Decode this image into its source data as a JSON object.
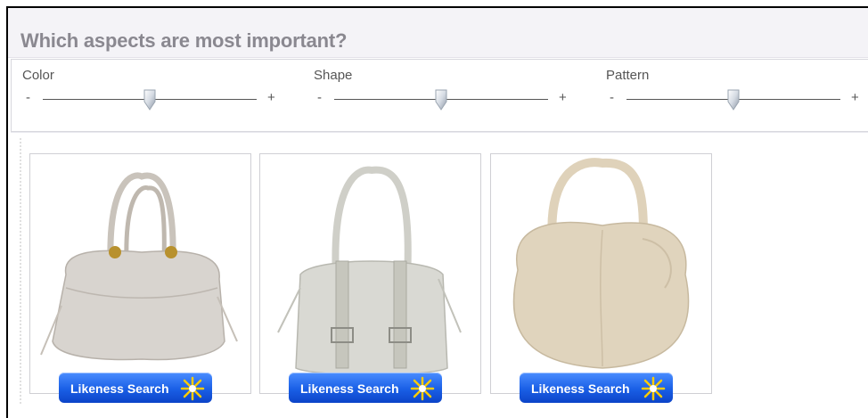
{
  "header": {
    "title": "Which aspects are most important?"
  },
  "sliders": [
    {
      "label": "Color",
      "minus": "-",
      "plus": "+",
      "value": 0.47
    },
    {
      "label": "Shape",
      "minus": "-",
      "plus": "+",
      "value": 0.47
    },
    {
      "label": "Pattern",
      "minus": "-",
      "plus": "+",
      "value": 0.47
    }
  ],
  "products": [
    {
      "button_label": "Likeness Search",
      "icon": "sparkle-icon",
      "color": "#d8d4cf"
    },
    {
      "button_label": "Likeness Search",
      "icon": "sparkle-icon",
      "color": "#d9d9d3"
    },
    {
      "button_label": "Likeness Search",
      "icon": "sparkle-icon",
      "color": "#e0d4bd"
    }
  ],
  "colors": {
    "header_bg": "#f4f3f7",
    "title": "#8a8890",
    "button": "#1a5fe6",
    "star": "#ffcc00"
  }
}
